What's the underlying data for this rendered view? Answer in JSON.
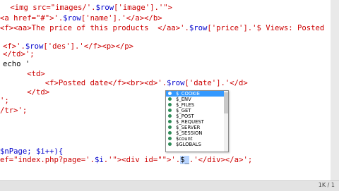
{
  "editor": {
    "lines": [
      {
        "tokens": [
          {
            "t": " <img src=\"images/'.",
            "c": "red"
          },
          {
            "t": "$row",
            "c": "blue"
          },
          {
            "t": "['image'].'\">",
            "c": "red"
          }
        ]
      },
      {
        "tokens": [
          {
            "t": "<a href=\"#\">'.",
            "c": "red"
          },
          {
            "t": "$row",
            "c": "blue"
          },
          {
            "t": "['name'].'</a></b>",
            "c": "red"
          }
        ]
      },
      {
        "tokens": [
          {
            "t": "<f><aa>The price of this products  </aa>'.",
            "c": "red"
          },
          {
            "t": "$row",
            "c": "blue"
          },
          {
            "t": "['price'].'$ Views: Posted",
            "c": "red"
          }
        ]
      },
      {
        "tokens": [
          {
            "t": "",
            "c": "black"
          }
        ]
      },
      {
        "tokens": [
          {
            "t": "<f>'.",
            "c": "red"
          },
          {
            "t": "$row",
            "c": "blue"
          },
          {
            "t": "['des'].'</f><p></p>",
            "c": "red"
          }
        ]
      },
      {
        "tokens": [
          {
            "t": "</td>';",
            "c": "red"
          }
        ]
      },
      {
        "tokens": [
          {
            "t": "echo '",
            "c": "black"
          }
        ]
      },
      {
        "tokens": [
          {
            "t": "      <td>",
            "c": "red"
          }
        ]
      },
      {
        "tokens": [
          {
            "t": "          <f>Posted date</f><br><d>'.",
            "c": "red"
          },
          {
            "t": "$row",
            "c": "blue"
          },
          {
            "t": "['date'].'</d>",
            "c": "red"
          }
        ]
      },
      {
        "tokens": [
          {
            "t": "      </td>",
            "c": "red"
          }
        ]
      },
      {
        "tokens": [
          {
            "t": "';",
            "c": "red"
          }
        ]
      },
      {
        "tokens": [
          {
            "t": "/tr>';",
            "c": "red"
          }
        ]
      },
      {
        "tokens": [
          {
            "t": "",
            "c": "black"
          }
        ]
      },
      {
        "tokens": [
          {
            "t": "",
            "c": "black"
          }
        ]
      },
      {
        "tokens": [
          {
            "t": "$nPage; $i++){",
            "c": "blue"
          }
        ]
      },
      {
        "tokens": [
          {
            "t": "ef=\"index.php?page='.",
            "c": "red"
          },
          {
            "t": "$i",
            "c": "blue"
          },
          {
            "t": ".'\"><div id=\"\">'.",
            "c": "red"
          },
          {
            "t": "$_",
            "c": "cursor"
          },
          {
            "t": ".'</div></a>';",
            "c": "red"
          }
        ]
      }
    ]
  },
  "autocomplete": {
    "items": [
      {
        "label": "$_COOKIE",
        "selected": true
      },
      {
        "label": "$_ENV",
        "selected": false
      },
      {
        "label": "$_FILES",
        "selected": false
      },
      {
        "label": "$_GET",
        "selected": false
      },
      {
        "label": "$_POST",
        "selected": false
      },
      {
        "label": "$_REQUEST",
        "selected": false
      },
      {
        "label": "$_SERVER",
        "selected": false
      },
      {
        "label": "$_SESSION",
        "selected": false
      },
      {
        "label": "$count",
        "selected": false
      },
      {
        "label": "$GLOBALS",
        "selected": false
      }
    ]
  },
  "status": {
    "text": "1K / 1"
  },
  "colors": {
    "string": "#cc0000",
    "variable": "#0000cc",
    "selection": "#3399ff"
  }
}
